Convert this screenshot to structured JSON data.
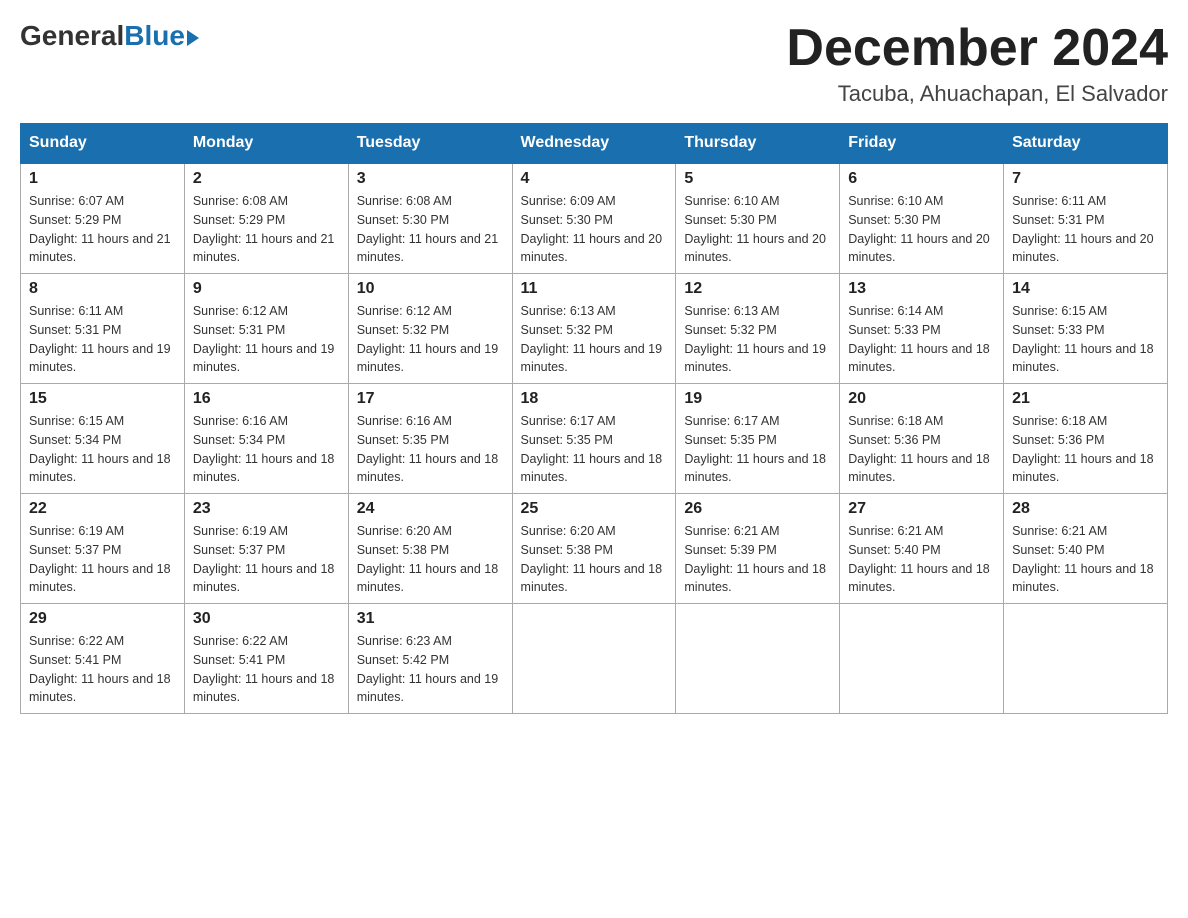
{
  "logo": {
    "general": "General",
    "blue": "Blue"
  },
  "title": {
    "month_year": "December 2024",
    "location": "Tacuba, Ahuachapan, El Salvador"
  },
  "weekdays": [
    "Sunday",
    "Monday",
    "Tuesday",
    "Wednesday",
    "Thursday",
    "Friday",
    "Saturday"
  ],
  "weeks": [
    [
      {
        "day": "1",
        "sunrise": "6:07 AM",
        "sunset": "5:29 PM",
        "daylight": "11 hours and 21 minutes."
      },
      {
        "day": "2",
        "sunrise": "6:08 AM",
        "sunset": "5:29 PM",
        "daylight": "11 hours and 21 minutes."
      },
      {
        "day": "3",
        "sunrise": "6:08 AM",
        "sunset": "5:30 PM",
        "daylight": "11 hours and 21 minutes."
      },
      {
        "day": "4",
        "sunrise": "6:09 AM",
        "sunset": "5:30 PM",
        "daylight": "11 hours and 20 minutes."
      },
      {
        "day": "5",
        "sunrise": "6:10 AM",
        "sunset": "5:30 PM",
        "daylight": "11 hours and 20 minutes."
      },
      {
        "day": "6",
        "sunrise": "6:10 AM",
        "sunset": "5:30 PM",
        "daylight": "11 hours and 20 minutes."
      },
      {
        "day": "7",
        "sunrise": "6:11 AM",
        "sunset": "5:31 PM",
        "daylight": "11 hours and 20 minutes."
      }
    ],
    [
      {
        "day": "8",
        "sunrise": "6:11 AM",
        "sunset": "5:31 PM",
        "daylight": "11 hours and 19 minutes."
      },
      {
        "day": "9",
        "sunrise": "6:12 AM",
        "sunset": "5:31 PM",
        "daylight": "11 hours and 19 minutes."
      },
      {
        "day": "10",
        "sunrise": "6:12 AM",
        "sunset": "5:32 PM",
        "daylight": "11 hours and 19 minutes."
      },
      {
        "day": "11",
        "sunrise": "6:13 AM",
        "sunset": "5:32 PM",
        "daylight": "11 hours and 19 minutes."
      },
      {
        "day": "12",
        "sunrise": "6:13 AM",
        "sunset": "5:32 PM",
        "daylight": "11 hours and 19 minutes."
      },
      {
        "day": "13",
        "sunrise": "6:14 AM",
        "sunset": "5:33 PM",
        "daylight": "11 hours and 18 minutes."
      },
      {
        "day": "14",
        "sunrise": "6:15 AM",
        "sunset": "5:33 PM",
        "daylight": "11 hours and 18 minutes."
      }
    ],
    [
      {
        "day": "15",
        "sunrise": "6:15 AM",
        "sunset": "5:34 PM",
        "daylight": "11 hours and 18 minutes."
      },
      {
        "day": "16",
        "sunrise": "6:16 AM",
        "sunset": "5:34 PM",
        "daylight": "11 hours and 18 minutes."
      },
      {
        "day": "17",
        "sunrise": "6:16 AM",
        "sunset": "5:35 PM",
        "daylight": "11 hours and 18 minutes."
      },
      {
        "day": "18",
        "sunrise": "6:17 AM",
        "sunset": "5:35 PM",
        "daylight": "11 hours and 18 minutes."
      },
      {
        "day": "19",
        "sunrise": "6:17 AM",
        "sunset": "5:35 PM",
        "daylight": "11 hours and 18 minutes."
      },
      {
        "day": "20",
        "sunrise": "6:18 AM",
        "sunset": "5:36 PM",
        "daylight": "11 hours and 18 minutes."
      },
      {
        "day": "21",
        "sunrise": "6:18 AM",
        "sunset": "5:36 PM",
        "daylight": "11 hours and 18 minutes."
      }
    ],
    [
      {
        "day": "22",
        "sunrise": "6:19 AM",
        "sunset": "5:37 PM",
        "daylight": "11 hours and 18 minutes."
      },
      {
        "day": "23",
        "sunrise": "6:19 AM",
        "sunset": "5:37 PM",
        "daylight": "11 hours and 18 minutes."
      },
      {
        "day": "24",
        "sunrise": "6:20 AM",
        "sunset": "5:38 PM",
        "daylight": "11 hours and 18 minutes."
      },
      {
        "day": "25",
        "sunrise": "6:20 AM",
        "sunset": "5:38 PM",
        "daylight": "11 hours and 18 minutes."
      },
      {
        "day": "26",
        "sunrise": "6:21 AM",
        "sunset": "5:39 PM",
        "daylight": "11 hours and 18 minutes."
      },
      {
        "day": "27",
        "sunrise": "6:21 AM",
        "sunset": "5:40 PM",
        "daylight": "11 hours and 18 minutes."
      },
      {
        "day": "28",
        "sunrise": "6:21 AM",
        "sunset": "5:40 PM",
        "daylight": "11 hours and 18 minutes."
      }
    ],
    [
      {
        "day": "29",
        "sunrise": "6:22 AM",
        "sunset": "5:41 PM",
        "daylight": "11 hours and 18 minutes."
      },
      {
        "day": "30",
        "sunrise": "6:22 AM",
        "sunset": "5:41 PM",
        "daylight": "11 hours and 18 minutes."
      },
      {
        "day": "31",
        "sunrise": "6:23 AM",
        "sunset": "5:42 PM",
        "daylight": "11 hours and 19 minutes."
      },
      null,
      null,
      null,
      null
    ]
  ]
}
